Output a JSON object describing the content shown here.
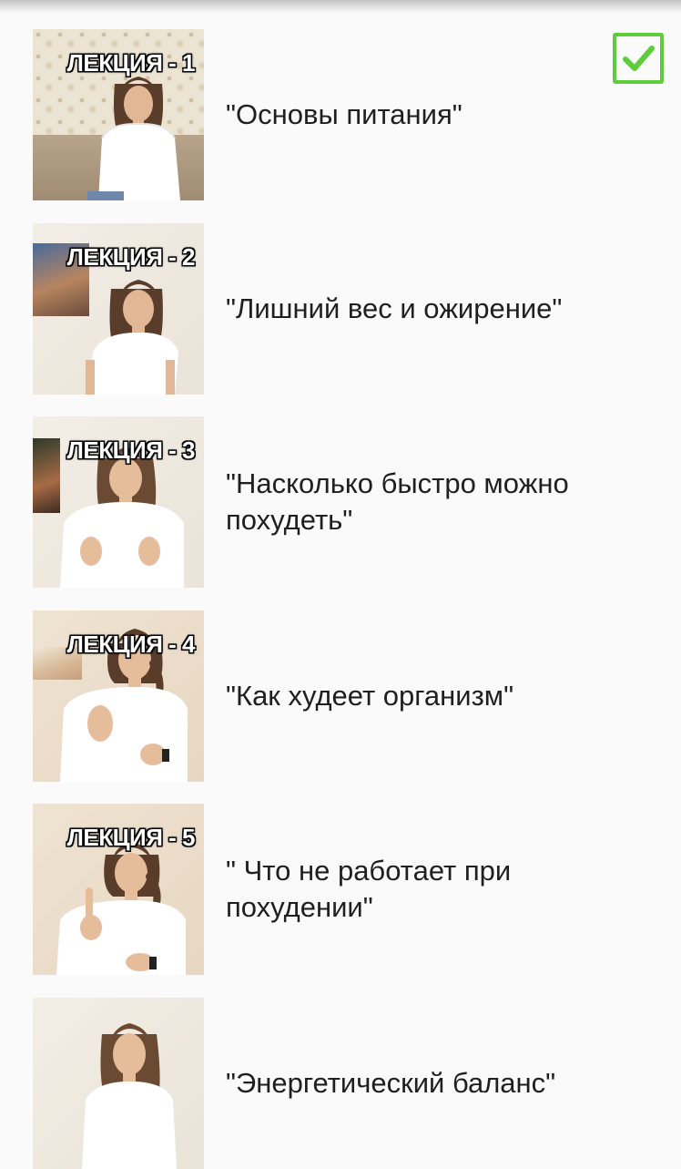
{
  "lectures": [
    {
      "badge": "ЛЕКЦИЯ - 1",
      "title": "\"Основы питания\"",
      "completed": true
    },
    {
      "badge": "ЛЕКЦИЯ - 2",
      "title": "\"Лишний вес и ожирение\"",
      "completed": false
    },
    {
      "badge": "ЛЕКЦИЯ - 3",
      "title": "\"Насколько быстро можно похудеть\"",
      "completed": false
    },
    {
      "badge": "ЛЕКЦИЯ - 4",
      "title": "\"Как худеет организм\"",
      "completed": false
    },
    {
      "badge": "ЛЕКЦИЯ - 5",
      "title": "\" Что не работает при похудении\"",
      "completed": false
    },
    {
      "badge": "",
      "title": "\"Энергетический баланс\"",
      "completed": false
    }
  ],
  "colors": {
    "check_green": "#5ecd3c",
    "background": "#fafafa",
    "title_text": "#1f1f1f"
  },
  "icons": {
    "completed": "checkbox-checked-icon"
  }
}
